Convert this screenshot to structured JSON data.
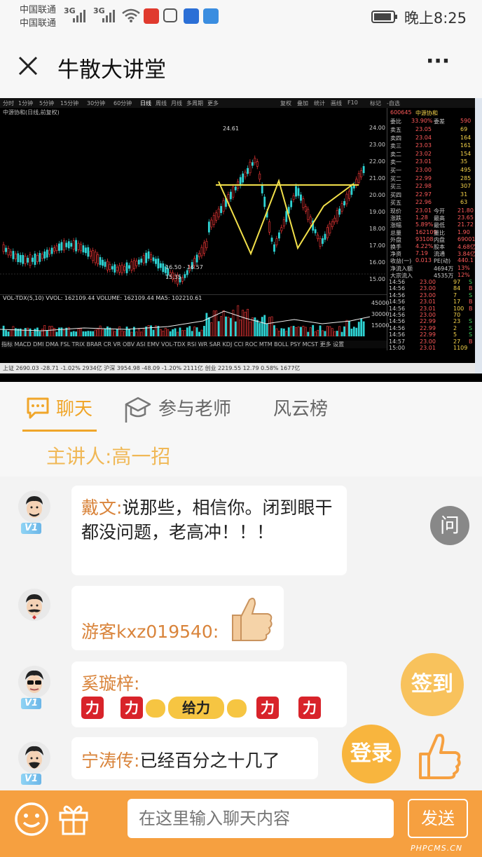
{
  "status_bar": {
    "carrier1": "中国联通",
    "carrier2": "中国联通",
    "net1": "3G",
    "net2": "3G",
    "time": "晚上8:25"
  },
  "nav": {
    "title": "牛散大讲堂",
    "menu": "···"
  },
  "stock_screen": {
    "periods": [
      "分时",
      "1分钟",
      "5分钟",
      "15分钟",
      "30分钟",
      "60分钟",
      "日线",
      "周线",
      "月线",
      "多周期",
      "更多"
    ],
    "tools": [
      "复权",
      "叠加",
      "统计",
      "画线",
      "F10",
      "标记",
      "-自选"
    ],
    "chart_caption": "中源协和(日线,前复权)",
    "price_high_label": "24.61",
    "price_low_label": "15.35",
    "range_label": "16.50 - 16.57",
    "vol_caption": "VOL-TDX(5,10)  VVOL: 162109.44  VOLUME: 162109.44  MA5: 102210.61",
    "y_ticks": [
      "24.00",
      "23.00",
      "22.00",
      "21.00",
      "20.00",
      "19.00",
      "18.00",
      "17.00",
      "16.00",
      "15.00"
    ],
    "vol_ticks": [
      "45000",
      "30000",
      "15000"
    ],
    "indicators": "指标 MACD DMI DMA FSL TRIX BRAR CR VR OBV ASI EMV VOL-TDX RSI WR SAR KDJ CCI ROC MTM BOLL PSY MCST 更多 设置",
    "stock_code": "600645",
    "stock_name": "中源协和",
    "weibi": {
      "label": "委比",
      "value": "33.90%",
      "label2": "委差",
      "value2": "590"
    },
    "asks": [
      {
        "label": "卖五",
        "price": "23.05",
        "vol": "69"
      },
      {
        "label": "卖四",
        "price": "23.04",
        "vol": "164"
      },
      {
        "label": "卖三",
        "price": "23.03",
        "vol": "161"
      },
      {
        "label": "卖二",
        "price": "23.02",
        "vol": "154"
      },
      {
        "label": "卖一",
        "price": "23.01",
        "vol": "35"
      }
    ],
    "bids": [
      {
        "label": "买一",
        "price": "23.00",
        "vol": "495"
      },
      {
        "label": "买二",
        "price": "22.99",
        "vol": "285"
      },
      {
        "label": "买三",
        "price": "22.98",
        "vol": "307"
      },
      {
        "label": "买四",
        "price": "22.97",
        "vol": "31"
      },
      {
        "label": "买五",
        "price": "22.96",
        "vol": "63"
      }
    ],
    "quote": [
      {
        "l1": "现价",
        "v1": "23.01",
        "l2": "今开",
        "v2": "21.80"
      },
      {
        "l1": "涨跌",
        "v1": "1.28",
        "l2": "最高",
        "v2": "23.65"
      },
      {
        "l1": "涨幅",
        "v1": "5.89%",
        "l2": "最低",
        "v2": "21.72"
      },
      {
        "l1": "总量",
        "v1": "162109",
        "l2": "量比",
        "v2": "1.90"
      },
      {
        "l1": "外盘",
        "v1": "93108",
        "l2": "内盘",
        "v2": "69001"
      },
      {
        "l1": "换手",
        "v1": "4.22%",
        "l2": "股本",
        "v2": "4.68亿"
      },
      {
        "l1": "净资",
        "v1": "7.19",
        "l2": "流通",
        "v2": "3.84亿"
      },
      {
        "l1": "收益(一)",
        "v1": "0.013",
        "l2": "PE(动)",
        "v2": "440.1"
      },
      {
        "l1": "净流入额",
        "v1": "",
        "l2": "4694万",
        "v2": "13%"
      },
      {
        "l1": "大宗流入",
        "v1": "",
        "l2": "4535万",
        "v2": "12%"
      }
    ],
    "ticks": [
      {
        "time": "14:56",
        "price": "23.00",
        "vol": "97",
        "flag": "S"
      },
      {
        "time": "14:56",
        "price": "23.00",
        "vol": "84",
        "flag": "B"
      },
      {
        "time": "14:56",
        "price": "23.00",
        "vol": "7",
        "flag": "S"
      },
      {
        "time": "14:56",
        "price": "23.01",
        "vol": "17",
        "flag": "B"
      },
      {
        "time": "14:56",
        "price": "23.01",
        "vol": "100",
        "flag": "B"
      },
      {
        "time": "14:56",
        "price": "23.00",
        "vol": "70",
        "flag": ""
      },
      {
        "time": "14:56",
        "price": "22.99",
        "vol": "23",
        "flag": "S"
      },
      {
        "time": "14:56",
        "price": "22.99",
        "vol": "2",
        "flag": "S"
      },
      {
        "time": "14:56",
        "price": "22.99",
        "vol": "5",
        "flag": "S"
      },
      {
        "time": "14:57",
        "price": "23.00",
        "vol": "27",
        "flag": "B"
      },
      {
        "time": "15:00",
        "price": "23.01",
        "vol": "1109",
        "flag": ""
      }
    ],
    "index_bar": "上证 2690.03 -28.71 -1.02% 2934亿   沪深 3954.98 -48.09 -1.20% 2111亿   创业 2219.55 12.79 0.58% 1677亿"
  },
  "tabs": {
    "chat": "聊天",
    "teachers": "参与老师",
    "ranking": "风云榜"
  },
  "presenter": "主讲人:高一招",
  "messages": [
    {
      "name": "戴文:",
      "text": "说那些，相信你。闭到眼干都没问题，老高冲！！！",
      "badge": "V1"
    },
    {
      "name": "游客kxz019540:",
      "text": "",
      "badge": ""
    },
    {
      "name": "奚璇梓:",
      "text": "",
      "badge": "V1",
      "sticker_chars": [
        "力",
        "力",
        "给力",
        "力",
        "力"
      ]
    },
    {
      "name": "宁涛传:",
      "text": "已经百分之十几了",
      "badge": "V1"
    }
  ],
  "floating": {
    "ask": "问",
    "checkin": "签到",
    "login": "登录"
  },
  "bottom": {
    "placeholder": "在这里输入聊天内容",
    "send": "发送"
  },
  "watermark": "PHPCMS.CN",
  "colors": {
    "accent": "#f0a62a",
    "name": "#d9843b",
    "bottom_bar": "#f6a040"
  }
}
